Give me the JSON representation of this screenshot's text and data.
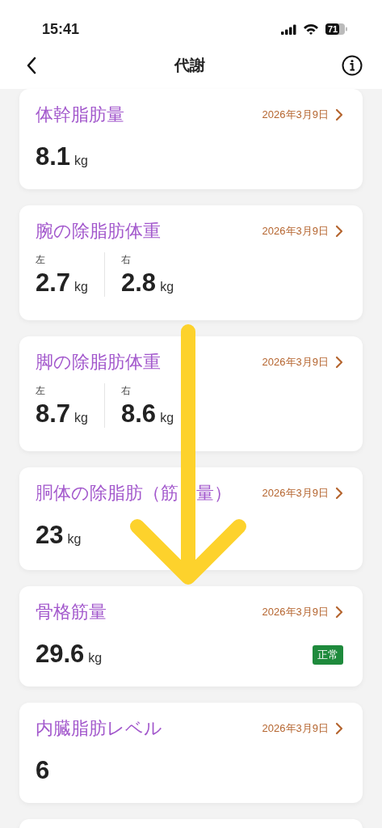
{
  "status_bar": {
    "time": "15:41",
    "battery": "71"
  },
  "nav": {
    "title": "代謝"
  },
  "cards": [
    {
      "kind": "single",
      "title": "体幹脂肪量",
      "date": "2026年3月9日",
      "value": "8.1",
      "unit": "kg"
    },
    {
      "kind": "split",
      "title": "腕の除脂肪体重",
      "date": "2026年3月9日",
      "sides": [
        {
          "label": "左",
          "value": "2.7",
          "unit": "kg"
        },
        {
          "label": "右",
          "value": "2.8",
          "unit": "kg"
        }
      ]
    },
    {
      "kind": "split",
      "title": "脚の除脂肪体重",
      "date": "2026年3月9日",
      "sides": [
        {
          "label": "左",
          "value": "8.7",
          "unit": "kg"
        },
        {
          "label": "右",
          "value": "8.6",
          "unit": "kg"
        }
      ]
    },
    {
      "kind": "single",
      "title_parts": [
        "胴体の除脂肪（筋",
        "量）"
      ],
      "date": "2026年3月9日",
      "value": "23",
      "unit": "kg"
    },
    {
      "kind": "single",
      "title": "骨格筋量",
      "date": "2026年3月9日",
      "value": "29.6",
      "unit": "kg",
      "badge": "正常"
    },
    {
      "kind": "single",
      "title": "内臓脂肪レベル",
      "date": "2026年3月9日",
      "value": "6"
    },
    {
      "kind": "empty"
    }
  ],
  "annotation": {
    "kind": "arrow"
  }
}
